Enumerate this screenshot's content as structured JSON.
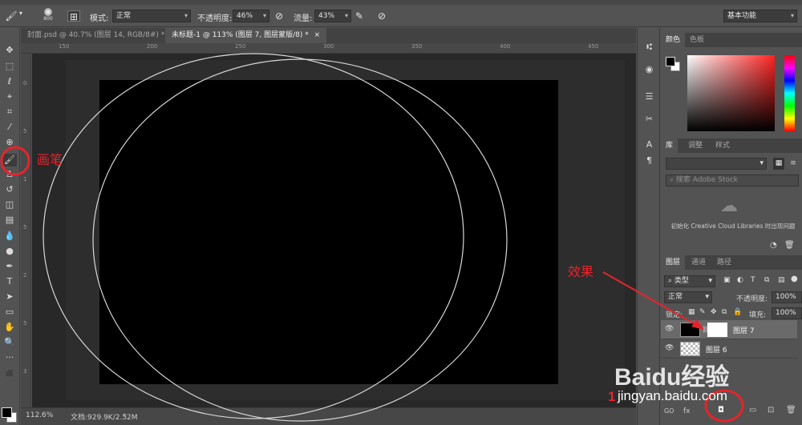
{
  "options_bar": {
    "brush_size": "800",
    "mode_label": "模式:",
    "mode_value": "正常",
    "opacity_label": "不透明度:",
    "opacity_value": "46%",
    "flow_label": "流量:",
    "flow_value": "43%",
    "workspace_value": "基本功能"
  },
  "doc_tabs": [
    {
      "label": "封面.psd @ 40.7% (图层 14, RGB/8#) *"
    },
    {
      "label": "未标题-1 @ 113% (图层 7, 图层蒙版/8) *"
    }
  ],
  "ruler_top": [
    "150",
    "200",
    "250",
    "300",
    "350",
    "400",
    "450"
  ],
  "ruler_left": [
    "0",
    "5",
    "1",
    "5",
    "2",
    "5",
    "3"
  ],
  "status": {
    "zoom": "112.6%",
    "doc_info": "文档:929.9K/2.52M"
  },
  "color_panel": {
    "tabs": [
      "颜色",
      "色板"
    ]
  },
  "library_panel": {
    "tabs": [
      "库",
      "调整",
      "样式"
    ],
    "search_placeholder": "搜索 Adobe Stock",
    "init_message": "初始化 Creative Cloud Libraries 时出现问题"
  },
  "layers_panel": {
    "tabs": [
      "图层",
      "通道",
      "路径"
    ],
    "filter_label": "类型",
    "blend_mode": "正常",
    "opacity_label": "不透明度:",
    "opacity_value": "100%",
    "lock_label": "锁定:",
    "fill_label": "填充:",
    "fill_value": "100%",
    "layers": [
      {
        "name": "图层 7",
        "selected": true
      },
      {
        "name": "图层 6",
        "selected": false
      }
    ]
  },
  "annotations": {
    "brush": "画笔",
    "effect": "效果",
    "step": "1"
  },
  "watermark": {
    "logo": "Baidu经验",
    "url": "jingyan.baidu.com"
  },
  "colors": {
    "accent_red": "#e8232b",
    "panel_bg": "#535353",
    "canvas": "#000000"
  }
}
